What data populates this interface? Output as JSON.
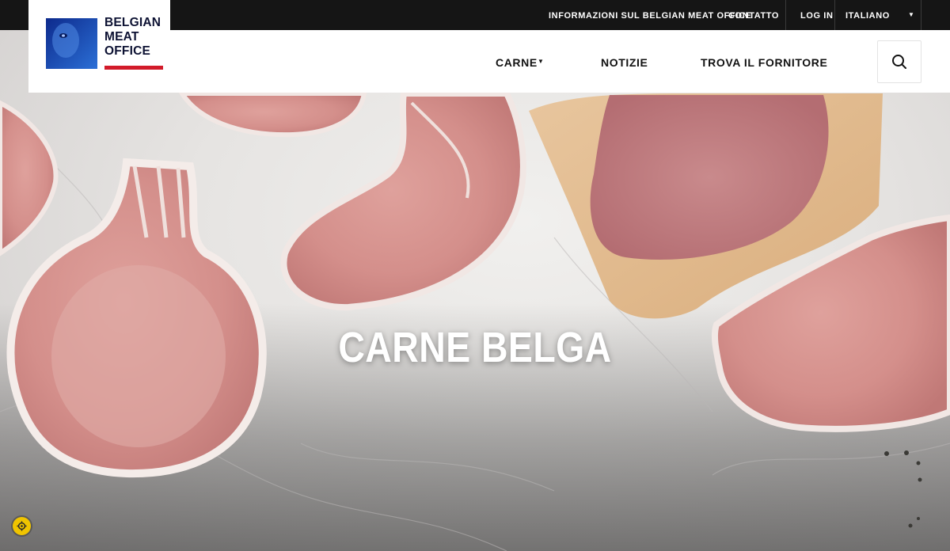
{
  "topbar": {
    "links": [
      {
        "label": "INFORMAZIONI SUL BELGIAN MEAT OFFICE"
      },
      {
        "label": "CONTATTO"
      },
      {
        "label": "LOG IN"
      }
    ],
    "language": "ITALIANO"
  },
  "logo": {
    "line1": "BELGIAN",
    "line2": "MEAT",
    "line3": "OFFICE",
    "accent": "#d21b2a"
  },
  "nav": {
    "items": [
      {
        "label": "CARNE",
        "has_dropdown": true
      },
      {
        "label": "NOTIZIE"
      },
      {
        "label": "TROVA IL FORNITORE"
      }
    ],
    "search_icon": "search-icon"
  },
  "hero": {
    "title": "CARNE BELGA"
  },
  "cookie_badge": {
    "icon": "cookie-settings-icon",
    "color": "#f0c400"
  }
}
